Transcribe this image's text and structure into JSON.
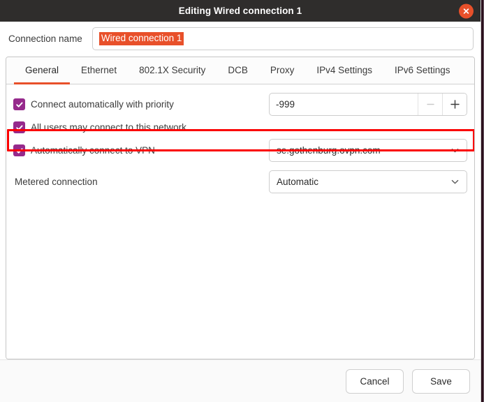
{
  "window": {
    "title": "Editing Wired connection 1",
    "close_icon": "close-icon"
  },
  "connection_name": {
    "label": "Connection name",
    "value": "Wired connection 1",
    "placeholder": "Connection name"
  },
  "tabs": [
    {
      "label": "General",
      "active": true
    },
    {
      "label": "Ethernet",
      "active": false
    },
    {
      "label": "802.1X Security",
      "active": false
    },
    {
      "label": "DCB",
      "active": false
    },
    {
      "label": "Proxy",
      "active": false
    },
    {
      "label": "IPv4 Settings",
      "active": false
    },
    {
      "label": "IPv6 Settings",
      "active": false
    }
  ],
  "general": {
    "connect_auto": {
      "label": "Connect automatically with priority",
      "checked": true,
      "priority_value": "-999",
      "decrement_icon": "minus-icon",
      "increment_icon": "plus-icon",
      "decrement_enabled": false,
      "increment_enabled": true
    },
    "all_users": {
      "label": "All users may connect to this network",
      "checked": true
    },
    "auto_vpn": {
      "label": "Automatically connect to VPN",
      "checked": true,
      "vpn_value": "se.gothenburg.ovpn.com",
      "dropdown_icon": "chevron-down-icon",
      "highlighted": true
    },
    "metered": {
      "label": "Metered connection",
      "value": "Automatic",
      "dropdown_icon": "chevron-down-icon"
    }
  },
  "footer": {
    "cancel_label": "Cancel",
    "save_label": "Save"
  },
  "colors": {
    "titlebar_bg": "#2f2d2c",
    "accent_orange": "#e8502a",
    "checkbox_purple": "#962a8c",
    "highlight_red": "#fb0000",
    "text": "#3b3b3b"
  }
}
